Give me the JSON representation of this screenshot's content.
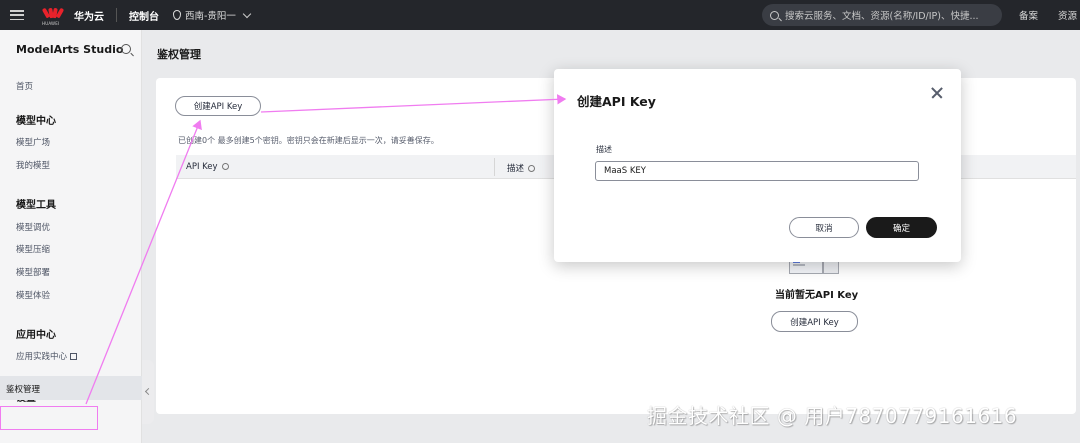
{
  "topbar": {
    "logo_text": "HUAWEI",
    "brand": "华为云",
    "console": "控制台",
    "region": "西南-贵阳一",
    "search_placeholder": "搜索云服务、文档、资源(名称/ID/IP)、快捷...",
    "link_filing": "备案",
    "link_resources": "资源"
  },
  "sidebar": {
    "title": "ModelArts Studio",
    "home": "首页",
    "group_model_center": "模型中心",
    "model_plaza": "模型广场",
    "my_models": "我的模型",
    "group_model_tools": "模型工具",
    "model_tuning": "模型调优",
    "model_compression": "模型压缩",
    "model_deploy": "模型部署",
    "model_experience": "模型体验",
    "group_app_center": "应用中心",
    "app_practice_center": "应用实践中心",
    "group_settings": "设置",
    "auth_management": "鉴权管理"
  },
  "main": {
    "page_title": "鉴权管理",
    "create_button": "创建API Key",
    "hint": "已创建0个  最多创建5个密钥。密钥只会在新建后显示一次，请妥善保存。",
    "col_api_key": "API Key",
    "col_description": "描述",
    "empty_text": "当前暂无API Key",
    "empty_create_button": "创建API Key"
  },
  "modal": {
    "title": "创建API Key",
    "field_label": "描述",
    "field_value": "MaaS KEY",
    "cancel": "取消",
    "confirm": "确定"
  },
  "annotation": {
    "color": "#f07cf0"
  },
  "watermark": "掘金技术社区 @ 用户7870779161616"
}
